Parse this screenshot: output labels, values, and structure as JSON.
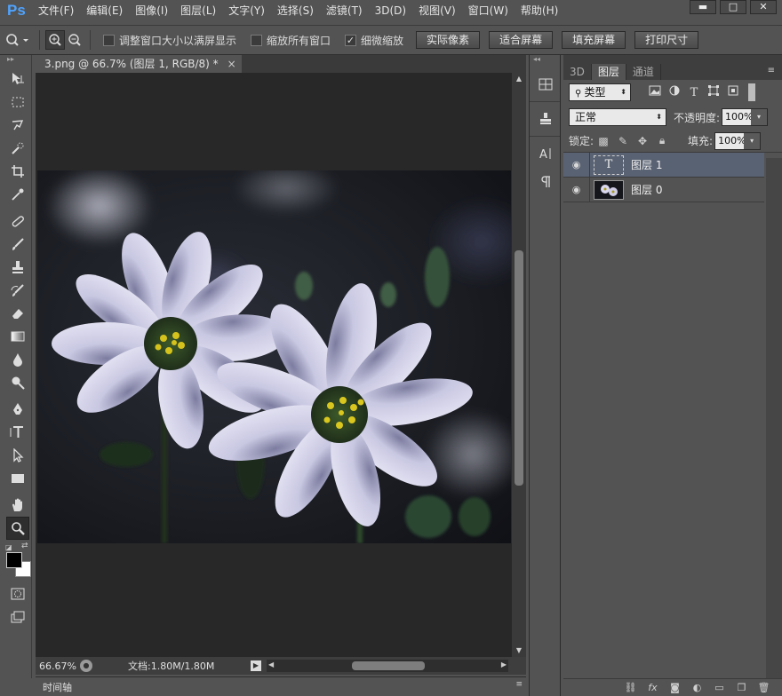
{
  "app": {
    "logo": "Ps"
  },
  "menu": [
    "文件(F)",
    "编辑(E)",
    "图像(I)",
    "图层(L)",
    "文字(Y)",
    "选择(S)",
    "滤镜(T)",
    "3D(D)",
    "视图(V)",
    "窗口(W)",
    "帮助(H)"
  ],
  "window_controls": {
    "minimize": "▬",
    "maximize": "□",
    "close": "✕"
  },
  "options_bar": {
    "resize_windows_label": "调整窗口大小以满屏显示",
    "resize_windows_checked": false,
    "zoom_all_label": "缩放所有窗口",
    "zoom_all_checked": false,
    "scrubby_zoom_label": "细微缩放",
    "scrubby_zoom_checked": true,
    "actual_pixels": "实际像素",
    "fit_screen": "适合屏幕",
    "fill_screen": "填充屏幕",
    "print_size": "打印尺寸"
  },
  "document": {
    "tab_title": "3.png @ 66.7% (图层 1, RGB/8) *",
    "close": "×"
  },
  "status": {
    "zoom": "66.67%",
    "doc_info": "文档:1.80M/1.80M"
  },
  "timeline": {
    "label": "时间轴"
  },
  "layers_panel": {
    "tabs": [
      "3D",
      "图层",
      "通道"
    ],
    "active_tab": "图层",
    "filter_kind": "类型",
    "blend_mode": "正常",
    "opacity_label": "不透明度:",
    "opacity_value": "100%",
    "lock_label": "锁定:",
    "fill_label": "填充:",
    "fill_value": "100%",
    "layers": [
      {
        "name": "图层 1",
        "type": "text",
        "thumb_glyph": "T",
        "selected": true
      },
      {
        "name": "图层 0",
        "type": "image",
        "selected": false
      }
    ]
  },
  "icons": {
    "tools": [
      "move-tool-icon",
      "marquee-tool-icon",
      "lasso-tool-icon",
      "quick-selection-icon",
      "crop-tool-icon",
      "eyedropper-icon",
      "healing-brush-icon",
      "brush-tool-icon",
      "clone-stamp-icon",
      "history-brush-icon",
      "eraser-icon",
      "gradient-tool-icon",
      "blur-tool-icon",
      "dodge-tool-icon",
      "pen-tool-icon",
      "type-tool-icon",
      "path-selection-icon",
      "rectangle-tool-icon",
      "hand-tool-icon",
      "zoom-tool-icon"
    ]
  },
  "colors": {
    "foreground": "#000000",
    "background": "#ffffff",
    "selected_layer": "#596272",
    "logo": "#4fa3ff"
  }
}
